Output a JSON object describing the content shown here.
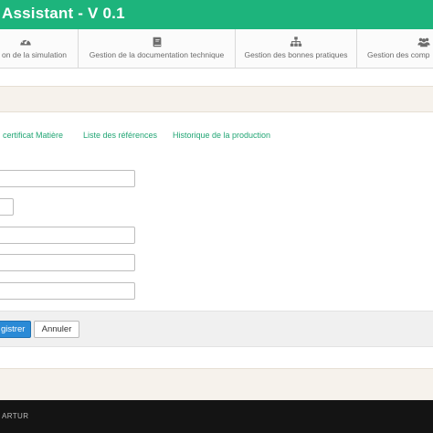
{
  "header": {
    "title": "Assistant - V 0.1",
    "bg_color": "#1db47c"
  },
  "nav": {
    "items": [
      {
        "label": "on de la simulation",
        "icon": "dashboard-gauge-icon"
      },
      {
        "label": "Gestion de la documentation technique",
        "icon": "book-icon"
      },
      {
        "label": "Gestion des bonnes pratiques",
        "icon": "sitemap-hierarchy-icon"
      },
      {
        "label": "Gestion des comp",
        "icon": "users-group-icon"
      }
    ]
  },
  "tabs": [
    {
      "label": "certificat Matière"
    },
    {
      "label": "Liste des références"
    },
    {
      "label": "Historique de la production"
    }
  ],
  "form": {
    "fields": [
      {
        "value": "",
        "placeholder": ""
      },
      {
        "value": "",
        "placeholder": ""
      },
      {
        "value": "",
        "placeholder": ""
      },
      {
        "value": "",
        "placeholder": ""
      },
      {
        "value": "",
        "placeholder": ""
      }
    ]
  },
  "actions": {
    "save_label": "gistrer",
    "cancel_label": "Annuler",
    "primary_color": "#2a8ad6"
  },
  "footer": {
    "text": "ARTUR"
  }
}
